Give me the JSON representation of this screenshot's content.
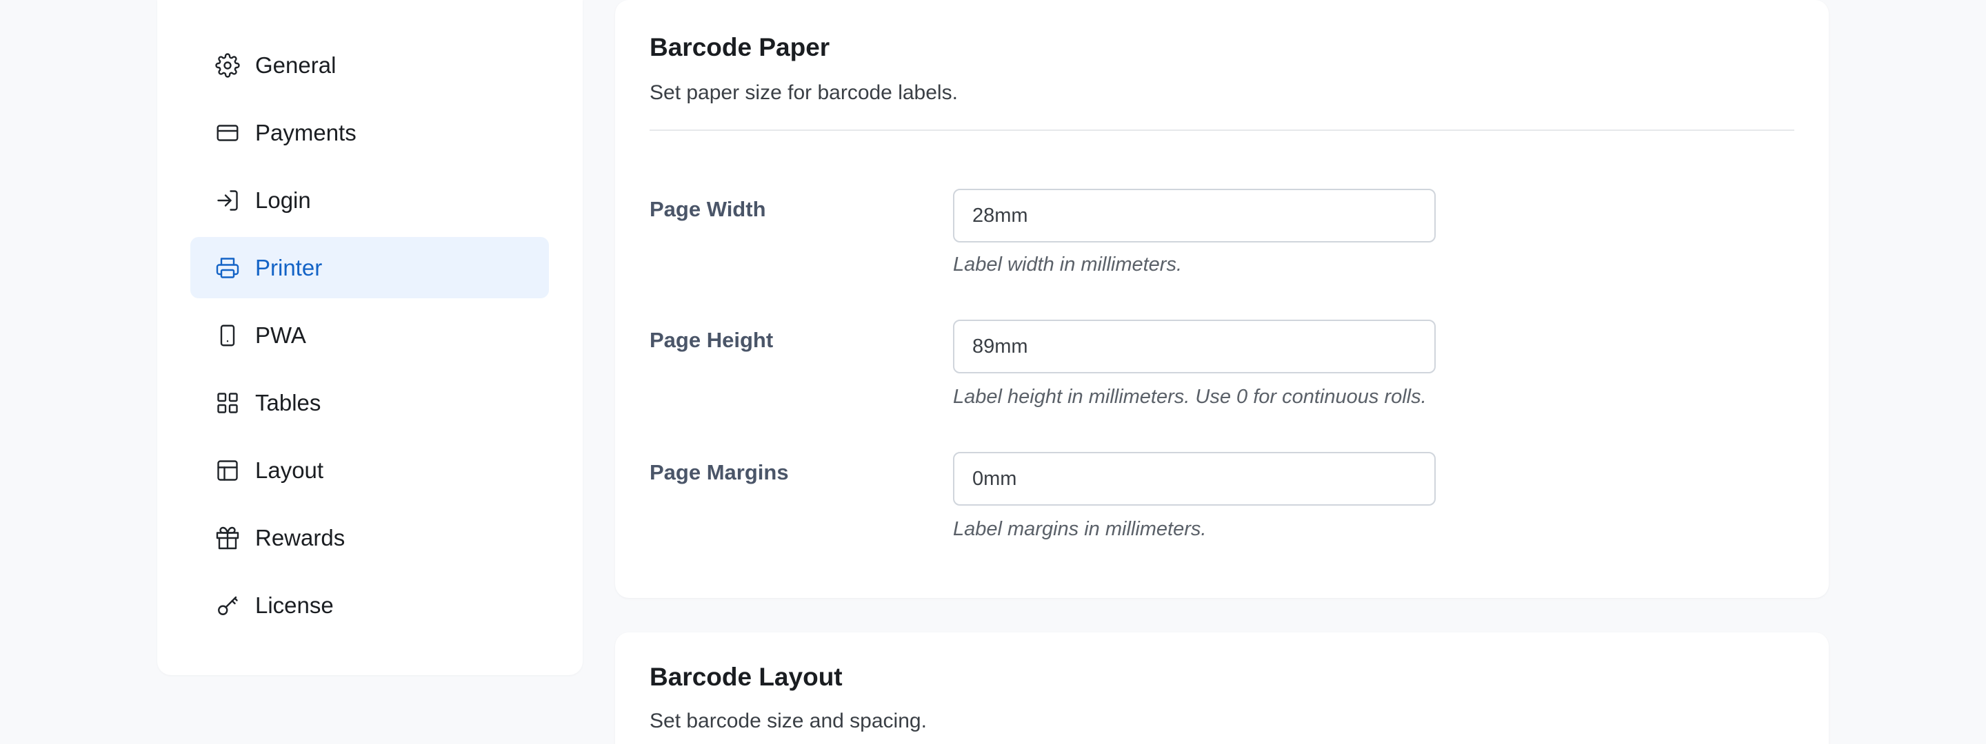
{
  "sidebar": {
    "items": [
      {
        "label": "General",
        "icon": "gear-icon",
        "active": false
      },
      {
        "label": "Payments",
        "icon": "credit-card-icon",
        "active": false
      },
      {
        "label": "Login",
        "icon": "login-icon",
        "active": false
      },
      {
        "label": "Printer",
        "icon": "printer-icon",
        "active": true
      },
      {
        "label": "PWA",
        "icon": "mobile-icon",
        "active": false
      },
      {
        "label": "Tables",
        "icon": "grid-icon",
        "active": false
      },
      {
        "label": "Layout",
        "icon": "layout-icon",
        "active": false
      },
      {
        "label": "Rewards",
        "icon": "gift-icon",
        "active": false
      },
      {
        "label": "License",
        "icon": "key-icon",
        "active": false
      }
    ],
    "active_color": "#1363c6",
    "active_bg": "#ebf3fe"
  },
  "barcode_paper": {
    "title": "Barcode Paper",
    "description": "Set paper size for barcode labels.",
    "fields": [
      {
        "label": "Page Width",
        "value": "28mm",
        "hint": "Label width in millimeters."
      },
      {
        "label": "Page Height",
        "value": "89mm",
        "hint": "Label height in millimeters. Use 0 for continuous rolls."
      },
      {
        "label": "Page Margins",
        "value": "0mm",
        "hint": "Label margins in millimeters."
      }
    ]
  },
  "barcode_layout": {
    "title": "Barcode Layout",
    "description": "Set barcode size and spacing."
  }
}
